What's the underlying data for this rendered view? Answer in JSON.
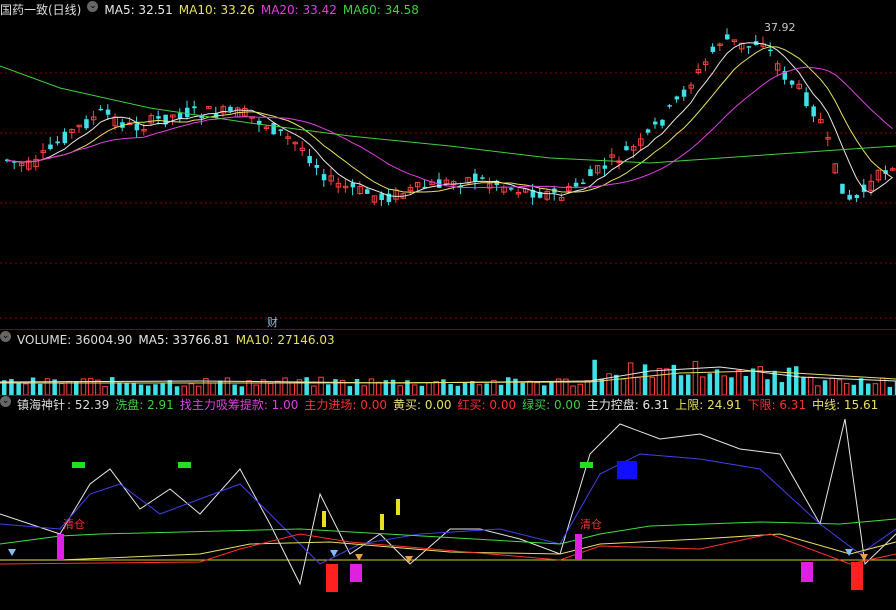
{
  "main_header": {
    "title": "国药一致(日线)",
    "ma5": "MA5: 32.51",
    "ma10": "MA10: 33.26",
    "ma20": "MA20: 33.42",
    "ma60": "MA60: 34.58"
  },
  "main_chart": {
    "peak_label": "37.92",
    "event_label": "财"
  },
  "volume_header": {
    "volume": "VOLUME: 36004.90",
    "ma5": "MA5: 33766.81",
    "ma10": "MA10: 27146.03"
  },
  "indicator_header": {
    "name": "镇海神针",
    "value": ": 52.39",
    "xipan": "洗盘: 2.91",
    "zhao": "找主力吸筹提款: 1.00",
    "jinchang": "主力进场: 0.00",
    "huangmai": "黄买: 0.00",
    "hongmai": "红买: 0.00",
    "lvmai": "绿买: 0.00",
    "kongpan": "主力控盘: 6.31",
    "shangxian": "上限: 24.91",
    "xiaxian": "下限: 6.31",
    "zhongxian": "中线: 15.61"
  },
  "indicator_labels": {
    "qingcang1": "清仓",
    "qingcang2": "清仓"
  },
  "colors": {
    "ma5": "#e8e8e8",
    "ma10": "#e8e060",
    "ma20": "#e040e0",
    "ma60": "#40d040",
    "up": "#ff4040",
    "down": "#40e0e8",
    "grid": "#8b0000"
  }
}
